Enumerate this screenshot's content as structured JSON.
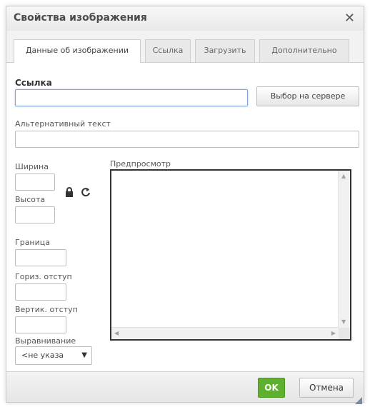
{
  "dialog": {
    "title": "Свойства изображения",
    "close_icon": "close-icon"
  },
  "tabs": [
    {
      "label": "Данные об изображении",
      "active": true
    },
    {
      "label": "Ссылка",
      "active": false
    },
    {
      "label": "Загрузить",
      "active": false
    },
    {
      "label": "Дополнительно",
      "active": false
    }
  ],
  "form": {
    "url_label": "Ссылка",
    "url_value": "",
    "browse_server_label": "Выбор на сервере",
    "alt_label": "Альтернативный текст",
    "alt_value": "",
    "width_label": "Ширина",
    "width_value": "",
    "height_label": "Высота",
    "height_value": "",
    "border_label": "Граница",
    "border_value": "",
    "hspace_label": "Гориз. отступ",
    "hspace_value": "",
    "vspace_label": "Вертик. отступ",
    "vspace_value": "",
    "align_label": "Выравнивание",
    "align_value": "<не указа"
  },
  "preview": {
    "label": "Предпросмотр"
  },
  "icons": {
    "lock": "lock-icon",
    "reset": "refresh-icon"
  },
  "footer": {
    "ok_label": "OK",
    "cancel_label": "Отмена"
  },
  "colors": {
    "ok_button": "#5db12f",
    "focus_border": "#7fa4d8"
  }
}
